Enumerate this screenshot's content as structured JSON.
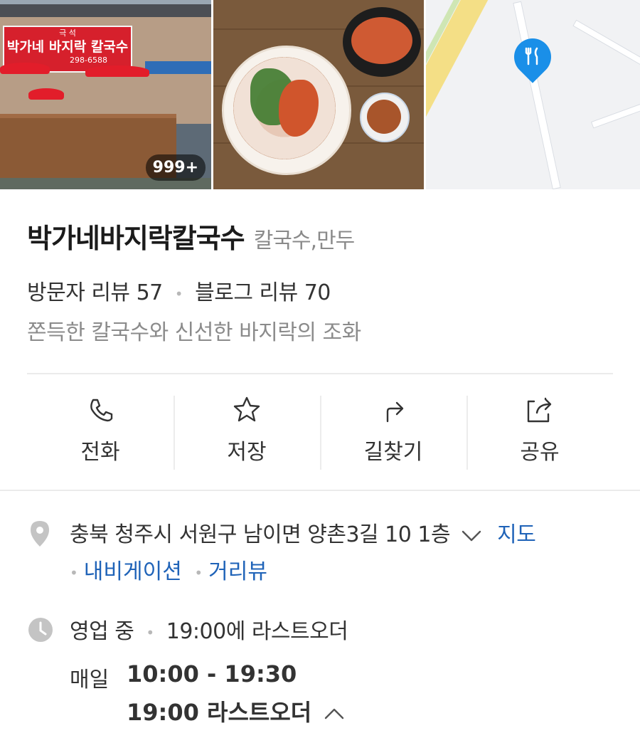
{
  "photos": {
    "count_badge": "999+",
    "sign": {
      "top": "극 석",
      "main": "박가네 바지락 칼국수",
      "phone": "298-6588"
    }
  },
  "place": {
    "name": "박가네바지락칼국수",
    "category": "칼국수,만두",
    "visitor_review": "방문자 리뷰 57",
    "blog_review": "블로그 리뷰 70",
    "description": "쫀득한 칼국수와 신선한 바지락의 조화"
  },
  "actions": [
    {
      "label": "전화",
      "icon": "phone-icon"
    },
    {
      "label": "저장",
      "icon": "star-icon"
    },
    {
      "label": "길찾기",
      "icon": "directions-icon"
    },
    {
      "label": "공유",
      "icon": "share-icon"
    }
  ],
  "address": {
    "text": "충북 청주시 서원구 남이면 양촌3길 10 1층",
    "map_link": "지도",
    "navigation_link": "내비게이션",
    "streetview_link": "거리뷰"
  },
  "hours": {
    "status": "영업 중",
    "last_order_note": "19:00에 라스트오더",
    "day": "매일",
    "time_range": "10:00 - 19:30",
    "last_order": "19:00 라스트오더"
  },
  "colors": {
    "link": "#1f63b8",
    "map_pin": "#1a8fe8",
    "icon_gray": "#c4c4c4"
  }
}
